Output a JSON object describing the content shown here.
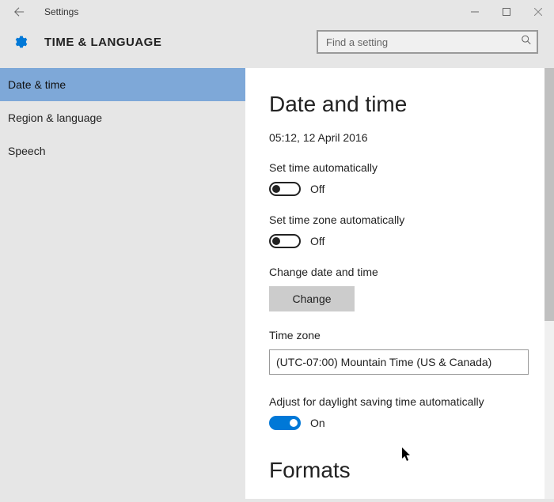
{
  "titlebar": {
    "title": "Settings"
  },
  "header": {
    "title": "TIME & LANGUAGE",
    "search_placeholder": "Find a setting"
  },
  "sidebar": {
    "items": [
      {
        "label": "Date & time",
        "active": true
      },
      {
        "label": "Region & language",
        "active": false
      },
      {
        "label": "Speech",
        "active": false
      }
    ]
  },
  "content": {
    "heading": "Date and time",
    "current_datetime": "05:12, 12 April 2016",
    "set_time_auto_label": "Set time automatically",
    "set_time_auto_state": "Off",
    "set_tz_auto_label": "Set time zone automatically",
    "set_tz_auto_state": "Off",
    "change_dt_label": "Change date and time",
    "change_button": "Change",
    "tz_label": "Time zone",
    "tz_value": "(UTC-07:00) Mountain Time (US & Canada)",
    "dst_label": "Adjust for daylight saving time automatically",
    "dst_state": "On",
    "formats_heading": "Formats"
  }
}
